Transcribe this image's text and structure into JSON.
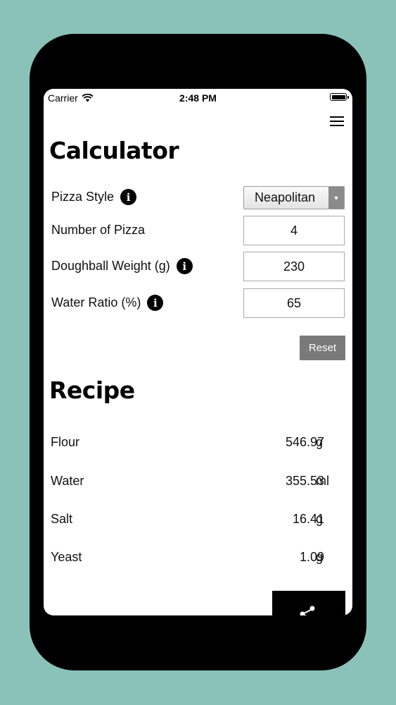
{
  "statusbar": {
    "carrier": "Carrier",
    "time": "2:48 PM"
  },
  "header": {
    "menu_icon": "hamburger-menu-icon"
  },
  "calculator": {
    "title": "Calculator",
    "fields": [
      {
        "label": "Pizza Style",
        "value": "Neapolitan",
        "has_info": true,
        "type": "select"
      },
      {
        "label": "Number of Pizza",
        "value": "4",
        "has_info": false,
        "type": "input"
      },
      {
        "label": "Doughball Weight (g)",
        "value": "230",
        "has_info": true,
        "type": "input"
      },
      {
        "label": "Water Ratio (%)",
        "value": "65",
        "has_info": true,
        "type": "input"
      }
    ],
    "reset_label": "Reset"
  },
  "recipe": {
    "title": "Recipe",
    "items": [
      {
        "label": "Flour",
        "value": "546.97",
        "unit": "g"
      },
      {
        "label": "Water",
        "value": "355.53",
        "unit": "ml"
      },
      {
        "label": "Salt",
        "value": "16.41",
        "unit": "g"
      },
      {
        "label": "Yeast",
        "value": "1.09",
        "unit": "g"
      }
    ],
    "share_icon": "share-icon"
  },
  "colors": {
    "background": "#8ac2b9",
    "device": "#000000",
    "reset_button": "#7a7a7a"
  }
}
